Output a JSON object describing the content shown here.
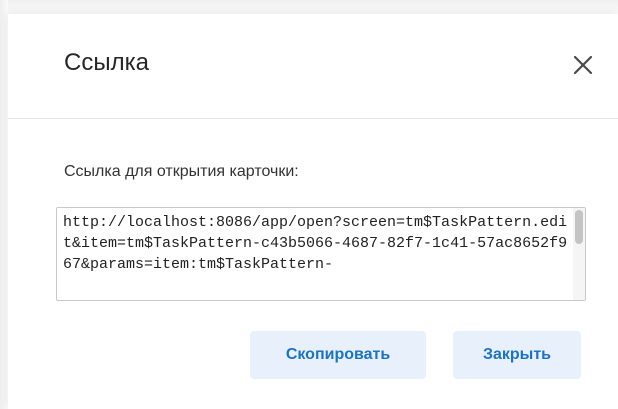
{
  "dialog": {
    "title": "Ссылка",
    "close_icon": "close-icon",
    "field_label": "Ссылка для открытия карточки:",
    "link_value": "http://localhost:8086/app/open?screen=tm$TaskPattern.edit&item=tm$TaskPattern-c43b5066-4687-82f7-1c41-57ac8652f967&params=item:tm$TaskPattern-",
    "copy_label": "Скопировать",
    "close_label": "Закрыть"
  },
  "colors": {
    "accent": "#1a73c8",
    "button_bg": "#e8f1fb",
    "border": "#c9c9c9"
  }
}
